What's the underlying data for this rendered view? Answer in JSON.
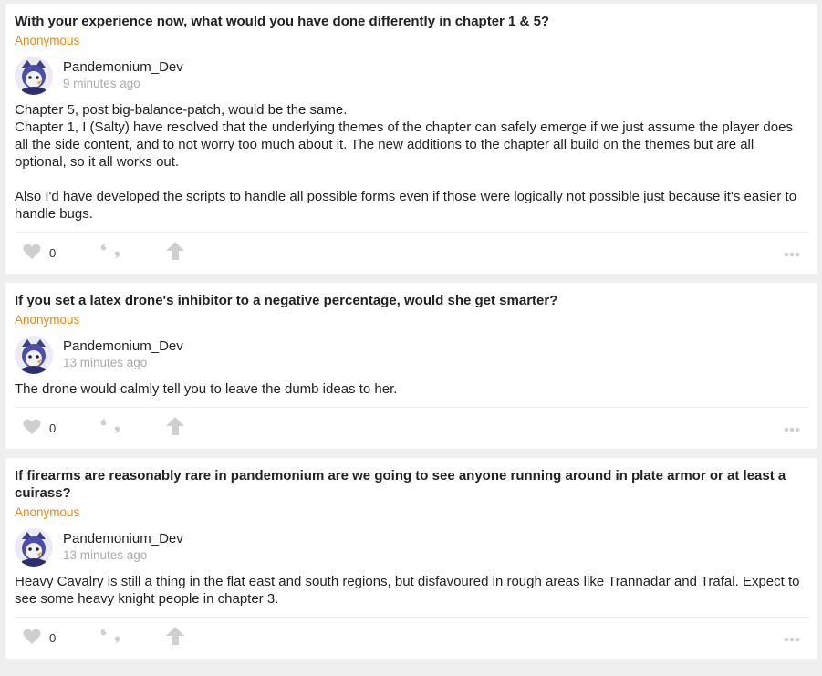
{
  "colors": {
    "background": "#efefef",
    "card": "#ffffff",
    "asker": "#e08a14",
    "muted": "#aaaaaa",
    "icon": "#cfcfcf"
  },
  "posts": [
    {
      "question": "With your experience now, what would you have done differently in chapter 1 & 5?",
      "asker": "Anonymous",
      "author": "Pandemonium_Dev",
      "time": "9 minutes ago",
      "answer_paragraphs": [
        "Chapter 5, post big-balance-patch, would be the same.\nChapter 1, I (Salty) have resolved that the underlying themes of the chapter can safely emerge if we just assume the player does all the side content, and to not worry too much about it. The new additions to the chapter all build on the themes but are all optional, so it all works out.",
        "Also I'd have developed the scripts to handle all possible forms even if those were logically not possible just because it's easier to handle bugs."
      ],
      "likes": "0"
    },
    {
      "question": "If you set a latex drone's inhibitor to a negative percentage, would she get smarter?",
      "asker": "Anonymous",
      "author": "Pandemonium_Dev",
      "time": "13 minutes ago",
      "answer_paragraphs": [
        "The drone would calmly tell you to leave the dumb ideas to her."
      ],
      "likes": "0"
    },
    {
      "question": "If firearms are reasonably rare in pandemonium are we going to see anyone running around in plate armor or at least a cuirass?",
      "asker": "Anonymous",
      "author": "Pandemonium_Dev",
      "time": "13 minutes ago",
      "answer_paragraphs": [
        "Heavy Cavalry is still a thing in the flat east and south regions, but disfavoured in rough areas like Trannadar and Trafal. Expect to see some heavy knight people in chapter 3."
      ],
      "likes": "0"
    }
  ],
  "icons": {
    "like": "heart-icon",
    "quote": "quote-icon",
    "share": "share-arrow-icon",
    "more": "more-dots-icon"
  }
}
